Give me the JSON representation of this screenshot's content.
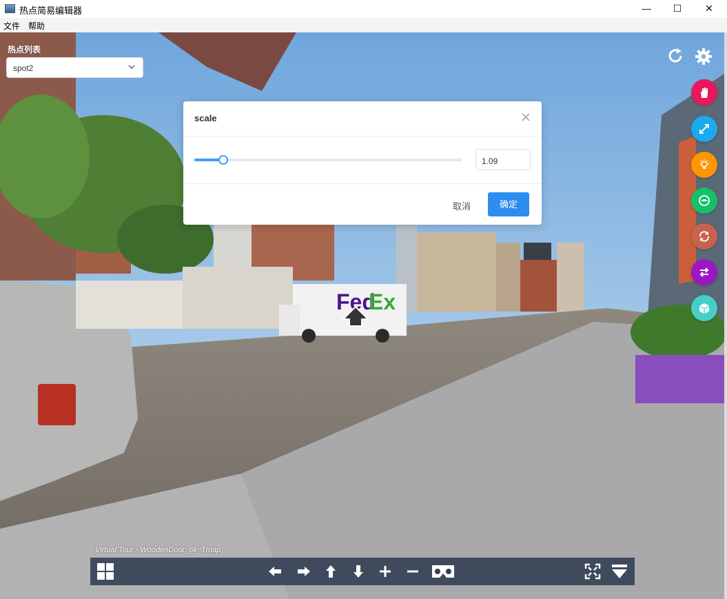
{
  "window": {
    "title": "热点简易编辑器",
    "minimize": "—",
    "maximize": "☐",
    "close": "✕"
  },
  "menu": {
    "items": [
      "文件",
      "帮助"
    ]
  },
  "panel": {
    "label": "热点列表",
    "selected_spot": "spot2"
  },
  "top_icons": [
    "refresh-icon",
    "gear-icon"
  ],
  "fabs": [
    {
      "name": "hand-icon",
      "color": "#e8185f"
    },
    {
      "name": "resize-icon",
      "color": "#1da9ee"
    },
    {
      "name": "bulb-icon",
      "color": "#ff9500"
    },
    {
      "name": "eye-icon",
      "color": "#16c06b"
    },
    {
      "name": "rotate-icon",
      "color": "#c7634d"
    },
    {
      "name": "swap-icon",
      "color": "#9b17c4"
    },
    {
      "name": "cube-icon",
      "color": "#46cfc6"
    }
  ],
  "dialog": {
    "title": "scale",
    "slider_value": 1.09,
    "slider_fraction": 0.108,
    "input_value": "1.09",
    "cancel_label": "取消",
    "ok_label": "确定"
  },
  "tour": {
    "label": "Virtual Tour - WoodenDoor_6k_Tmap"
  },
  "toolbar": {
    "icons": [
      "thumbs-icon",
      "left-arrow-icon",
      "right-arrow-icon",
      "up-arrow-icon",
      "down-arrow-icon",
      "zoom-in-icon",
      "zoom-out-icon",
      "vr-icon",
      "fullscreen-icon",
      "hide-bar-icon"
    ]
  },
  "colors": {
    "accent": "#409eff",
    "ok_button": "#2d8cf0",
    "toolbar": "#303e52"
  }
}
